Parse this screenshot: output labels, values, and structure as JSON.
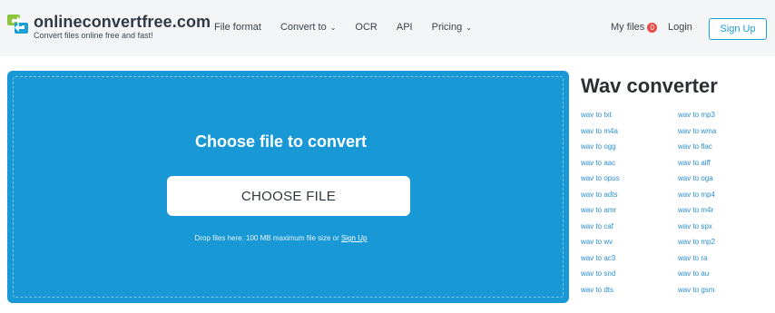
{
  "brand": {
    "name": "onlineconvertfree.com",
    "tagline": "Convert files online free and fast!",
    "colors": {
      "green": "#8cc63f",
      "blue": "#1ba1d9"
    }
  },
  "nav": {
    "file_format": "File format",
    "convert_to": "Convert to",
    "ocr": "OCR",
    "api": "API",
    "pricing": "Pricing"
  },
  "header": {
    "my_files": "My files",
    "my_files_count": "0",
    "login": "Login",
    "signup": "Sign Up"
  },
  "upload": {
    "title": "Choose file to convert",
    "button": "CHOOSE FILE",
    "drop_text": "Drop files here. 100 MB maximum file size or",
    "signup_link": "Sign Up",
    "background": "#1899d6"
  },
  "sidebar": {
    "title": "Wav converter",
    "col1": [
      "wav to txt",
      "wav to m4a",
      "wav to ogg",
      "wav to aac",
      "wav to opus",
      "wav to adts",
      "wav to amr",
      "wav to caf",
      "wav to wv",
      "wav to ac3",
      "wav to snd",
      "wav to dts"
    ],
    "col2": [
      "wav to mp3",
      "wav to wma",
      "wav to flac",
      "wav to aiff",
      "wav to oga",
      "wav to mp4",
      "wav to m4r",
      "wav to spx",
      "wav to mp2",
      "wav to ra",
      "wav to au",
      "wav to gsm"
    ]
  }
}
